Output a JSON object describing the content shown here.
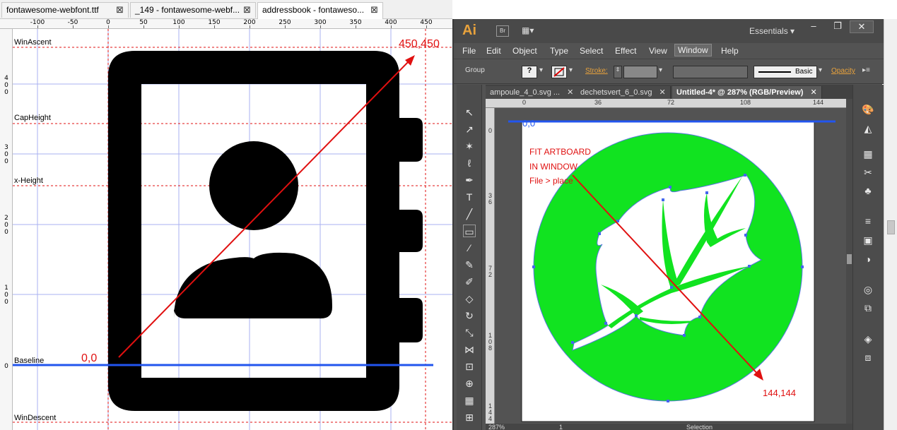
{
  "left_editor": {
    "tabs": [
      {
        "label": "fontawesome-webfont.ttf",
        "close": "⊠"
      },
      {
        "label": "_149 - fontawesome-webf...",
        "close": "⊠"
      },
      {
        "label": "addressbook - fontaweso...",
        "close": "⊠"
      }
    ],
    "hruler_labels": [
      "-100",
      "-50",
      "0",
      "50",
      "100",
      "150",
      "200",
      "250",
      "300",
      "350",
      "400",
      "450"
    ],
    "vruler_labels": [
      {
        "text": "4\n0\n0"
      },
      {
        "text": "3\n0\n0"
      },
      {
        "text": "2\n0\n0"
      },
      {
        "text": "1\n0\n0"
      },
      {
        "text": "0"
      }
    ],
    "metrics": {
      "win_ascent": "WinAscent",
      "cap_height": "CapHeight",
      "x_height": "x-Height",
      "baseline": "Baseline",
      "win_descent": "WinDescent"
    },
    "origin_label": "0,0",
    "corner_label": "450,450",
    "colors": {
      "guide": "#e01010",
      "baseline": "#2255ee",
      "glyph": "#000000"
    },
    "glyph_icon": "addressbook-icon"
  },
  "illustrator": {
    "logo": "Ai",
    "bridge": "Br",
    "workspace": "Essentials",
    "window_controls": [
      "–",
      "❐",
      "✕"
    ],
    "menu": [
      "File",
      "Edit",
      "Object",
      "Type",
      "Select",
      "Effect",
      "View",
      "Window",
      "Help"
    ],
    "control_bar": {
      "selection": "Group",
      "stroke_label": "Stroke:",
      "brush": "Basic",
      "opacity_label": "Opacity"
    },
    "doc_tabs": [
      {
        "label": "ampoule_4_0.svg ...",
        "close": "✕"
      },
      {
        "label": "dechetsvert_6_0.svg",
        "close": "✕"
      },
      {
        "label": "Untitled-4* @ 287% (RGB/Preview)",
        "close": "✕"
      }
    ],
    "ruler_labels": [
      "0",
      "36",
      "72",
      "108",
      "144"
    ],
    "vruler_labels": [
      "0",
      "3\n6",
      "7\n2",
      "1\n0\n8",
      "1\n4\n4"
    ],
    "annotation": [
      "FIT ARTBOARD",
      "IN WINDOW",
      "File > place"
    ],
    "origin_label": "0,0",
    "corner_label": "144,144",
    "status": {
      "zoom": "287%",
      "page": "1",
      "tool": "Selection"
    },
    "colors": {
      "circle": "#11e320",
      "annotation": "#e01010",
      "origin_line": "#2255ee"
    },
    "artwork_icon": "leaf-icon"
  }
}
